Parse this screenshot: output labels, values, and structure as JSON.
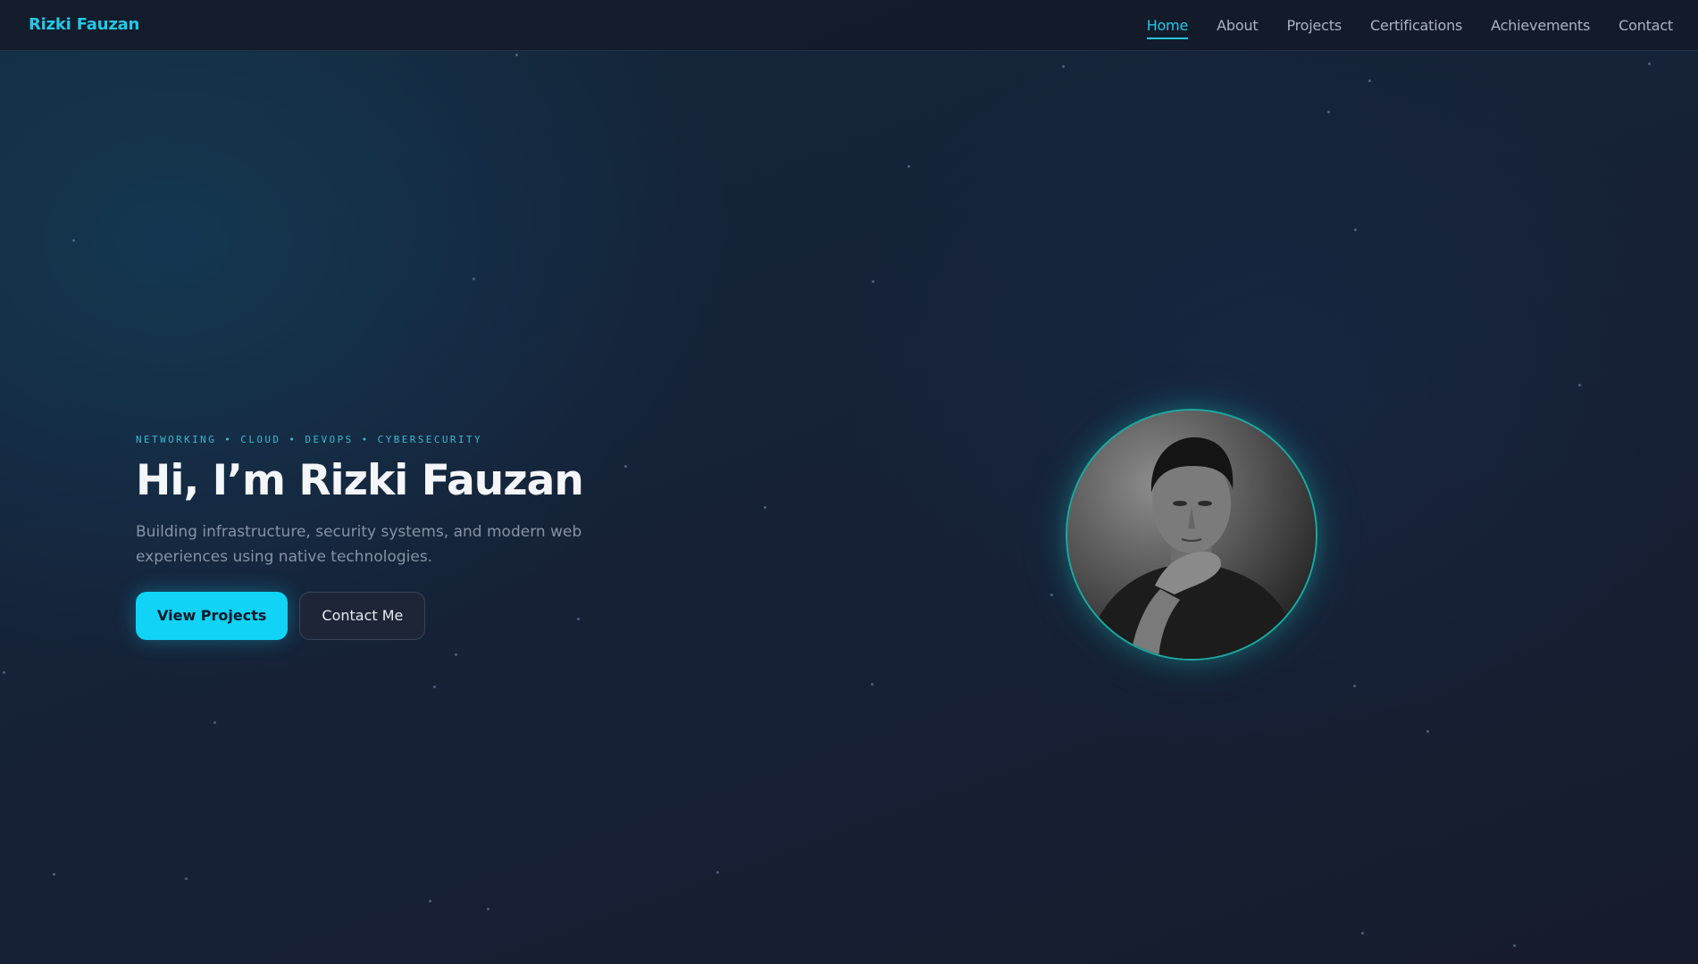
{
  "brand": {
    "name": "Rizki Fauzan"
  },
  "nav": {
    "items": [
      {
        "label": "Home",
        "active": true
      },
      {
        "label": "About"
      },
      {
        "label": "Projects"
      },
      {
        "label": "Certifications"
      },
      {
        "label": "Achievements"
      },
      {
        "label": "Contact"
      }
    ]
  },
  "hero": {
    "tagline": "NETWORKING • CLOUD • DEVOPS • CYBERSECURITY",
    "title": "Hi, I’m Rizki Fauzan",
    "subtitle": "Building infrastructure, security systems, and modern web experiences using native technologies.",
    "primary_button": "View Projects",
    "secondary_button": "Contact Me"
  },
  "colors": {
    "accent": "#22c8e6",
    "primary_button": "#10d3f5",
    "portrait_ring": "#1aa9a0",
    "background": "#141c2c"
  }
}
